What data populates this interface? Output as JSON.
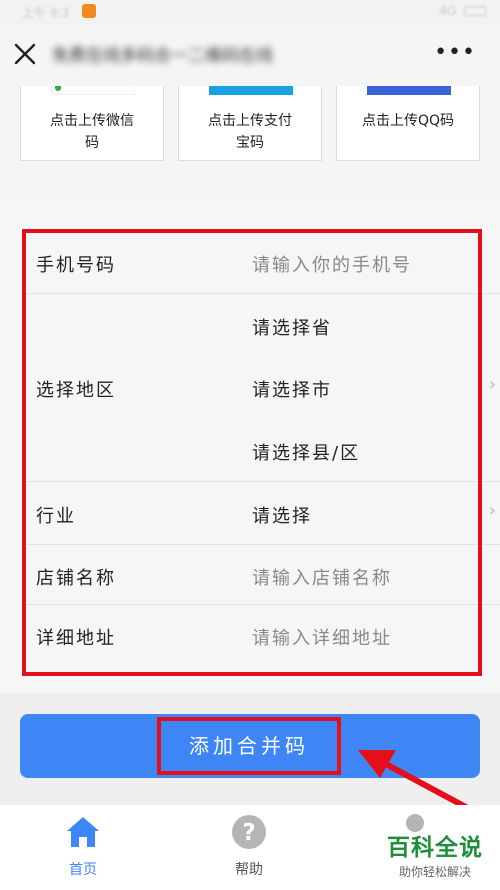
{
  "status_bar": {
    "left": "上午 9:3",
    "right": "4G"
  },
  "nav": {
    "title": "免费在线多码合一二维码在线",
    "more": "•••"
  },
  "upload_cards": [
    {
      "label": "点击上传微信码"
    },
    {
      "label": "点击上传支付宝码"
    },
    {
      "label": "点击上传QQ码"
    }
  ],
  "form": {
    "phone": {
      "label": "手机号码",
      "placeholder": "请输入你的手机号"
    },
    "region": {
      "label": "选择地区",
      "province": "请选择省",
      "city": "请选择市",
      "county": "请选择县/区"
    },
    "industry": {
      "label": "行业",
      "value": "请选择"
    },
    "shop_name": {
      "label": "店铺名称",
      "placeholder": "请输入店铺名称"
    },
    "address": {
      "label": "详细地址",
      "placeholder": "请输入详细地址"
    }
  },
  "submit": {
    "label": "添加合并码"
  },
  "tabs": [
    {
      "label": "首页",
      "icon": "home-icon",
      "color": "#3e86f6"
    },
    {
      "label": "帮助",
      "icon": "help-icon",
      "color": "#b5b5b5"
    },
    {
      "label": "",
      "icon": "profile-icon",
      "color": "#b5b5b5"
    }
  ],
  "watermark": {
    "title": "百科全说",
    "subtitle": "助你轻松解决"
  },
  "colors": {
    "primary": "#3e86f6",
    "highlight_box": "#e50f1a",
    "watermark": "#1f8f3a"
  }
}
